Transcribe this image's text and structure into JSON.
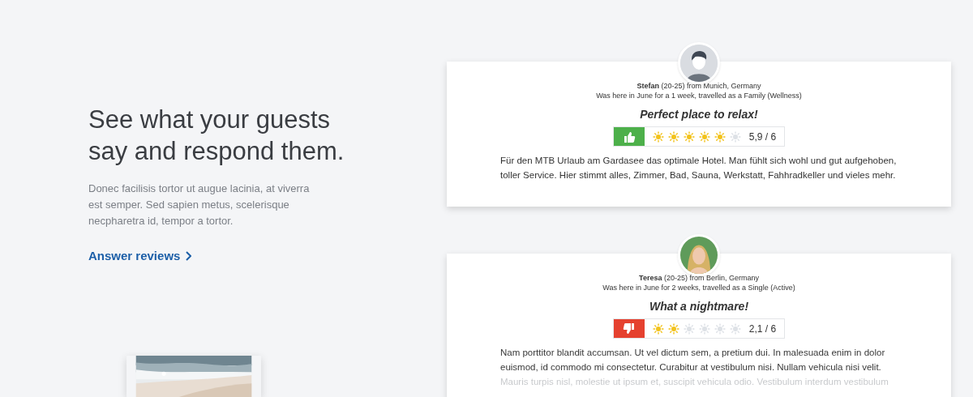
{
  "intro": {
    "heading_lines": [
      "See what your guests",
      "say and respond them."
    ],
    "text": "Donec facilisis tortor ut augue lacinia, at viverra est semper. Sed sapien metus, scelerisque necpharetra id, tempor a tortor.",
    "link": "Answer reviews"
  },
  "reviews": [
    {
      "avatar_photo": false,
      "author": "**Stefan** (20-25) from Munich, Germany",
      "stay": "Was here in June for a 1 week, travelled as a Family (Wellness)",
      "title": "Perfect place to relax!",
      "positive": true,
      "stars": 5,
      "score": "5,9 / 6",
      "text": "Für den MTB Urlaub am Gardasee das optimale Hotel. Man fühlt sich wohl und gut aufgehoben, toller Service. Hier stimmt alles, Zimmer, Bad, Sauna, Werkstatt, Fahhradkeller und vieles mehr.",
      "faded": false
    },
    {
      "avatar_photo": true,
      "author": "**Teresa** (20-25) from Berlin, Germany",
      "stay": "Was here in June for 2 weeks, travelled as a Single (Active)",
      "title": "What a nightmare!",
      "positive": false,
      "stars": 2,
      "score": "2,1 / 6",
      "text": "Nam porttitor blandit accumsan. Ut vel dictum sem, a pretium dui. In malesuada enim in dolor euismod, id commodo mi consectetur. Curabitur at vestibulum nisi. Nullam vehicula nisi velit. Mauris turpis nisl, molestie ut ipsum et, suscipit vehicula odio. Vestibulum interdum vestibulum",
      "faded": true
    }
  ]
}
